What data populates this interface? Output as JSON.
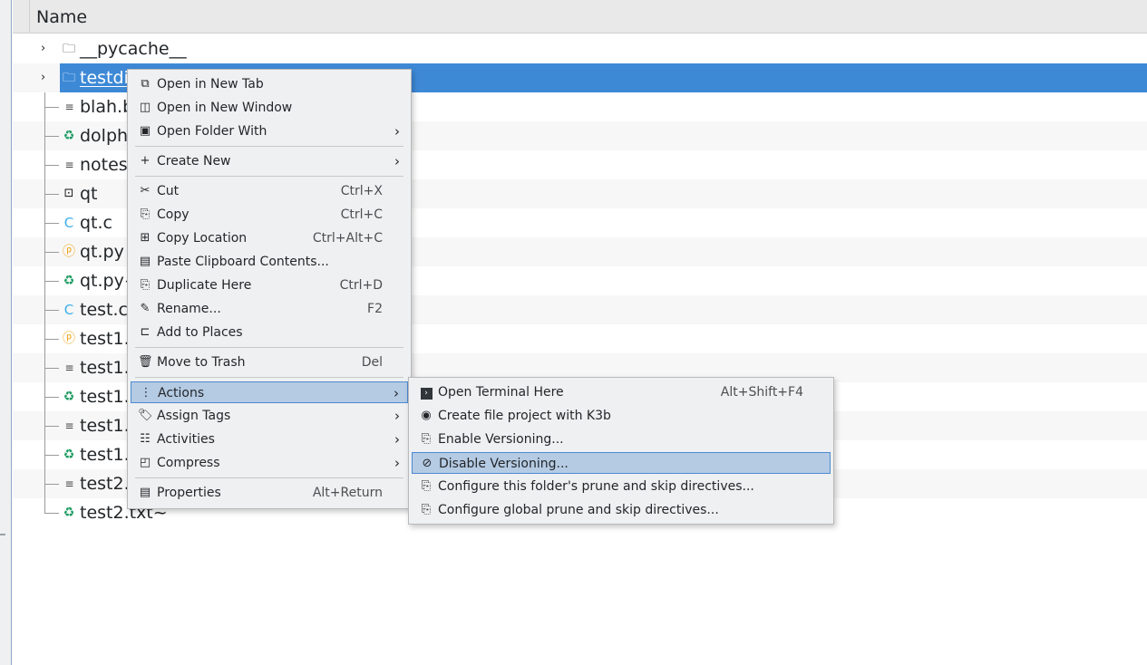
{
  "header": {
    "column_name": "Name"
  },
  "files": [
    {
      "name": "__pycache__",
      "icon": "folder-icon"
    },
    {
      "name": "testdi",
      "icon": "folder-icon",
      "selected": true
    },
    {
      "name": "blah.b",
      "icon": "text-file-icon"
    },
    {
      "name": "dolph",
      "icon": "backup-file-icon"
    },
    {
      "name": "notes",
      "icon": "text-file-icon"
    },
    {
      "name": "qt",
      "icon": "executable-icon"
    },
    {
      "name": "qt.c",
      "icon": "c-source-icon"
    },
    {
      "name": "qt.py",
      "icon": "python-file-icon"
    },
    {
      "name": "qt.py~",
      "icon": "backup-file-icon"
    },
    {
      "name": "test.c",
      "icon": "c-source-icon"
    },
    {
      "name": "test1.",
      "icon": "python-file-icon"
    },
    {
      "name": "test1.",
      "icon": "text-file-icon"
    },
    {
      "name": "test1.",
      "icon": "backup-file-icon"
    },
    {
      "name": "test1.",
      "icon": "text-file-icon"
    },
    {
      "name": "test1.",
      "icon": "backup-file-icon"
    },
    {
      "name": "test2.",
      "icon": "text-file-icon"
    },
    {
      "name": "test2.txt~",
      "icon": "backup-file-icon"
    }
  ],
  "context_menu": {
    "items": [
      {
        "label": "Open in New Tab",
        "shortcut": "",
        "icon": "new-tab-icon"
      },
      {
        "label": "Open in New Window",
        "shortcut": "",
        "icon": "new-window-icon"
      },
      {
        "label": "Open Folder With",
        "shortcut": "",
        "icon": "open-with-icon",
        "submenu": true
      },
      {
        "label": "Create New",
        "shortcut": "",
        "icon": "plus-icon",
        "submenu": true
      },
      {
        "label": "Cut",
        "shortcut": "Ctrl+X",
        "icon": "scissors-icon"
      },
      {
        "label": "Copy",
        "shortcut": "Ctrl+C",
        "icon": "copy-icon"
      },
      {
        "label": "Copy Location",
        "shortcut": "Ctrl+Alt+C",
        "icon": "copy-location-icon"
      },
      {
        "label": "Paste Clipboard Contents...",
        "shortcut": "",
        "icon": "paste-icon"
      },
      {
        "label": "Duplicate Here",
        "shortcut": "Ctrl+D",
        "icon": "duplicate-icon"
      },
      {
        "label": "Rename...",
        "shortcut": "F2",
        "icon": "pencil-icon"
      },
      {
        "label": "Add to Places",
        "shortcut": "",
        "icon": "bookmark-icon"
      },
      {
        "label": "Move to Trash",
        "shortcut": "Del",
        "icon": "trash-icon"
      },
      {
        "label": "Actions",
        "shortcut": "",
        "icon": "kebab-icon",
        "submenu": true,
        "active": true
      },
      {
        "label": "Assign Tags",
        "shortcut": "",
        "icon": "tag-icon",
        "submenu": true
      },
      {
        "label": "Activities",
        "shortcut": "",
        "icon": "activities-icon",
        "submenu": true
      },
      {
        "label": "Compress",
        "shortcut": "",
        "icon": "compress-icon",
        "submenu": true
      },
      {
        "label": "Properties",
        "shortcut": "Alt+Return",
        "icon": "properties-icon"
      }
    ]
  },
  "actions_submenu": {
    "items": [
      {
        "label": "Open Terminal Here",
        "shortcut": "Alt+Shift+F4",
        "icon": "terminal-icon"
      },
      {
        "label": "Create file project with K3b",
        "shortcut": "",
        "icon": "k3b-icon"
      },
      {
        "label": "Enable Versioning...",
        "shortcut": "",
        "icon": "versioning-icon"
      },
      {
        "label": "Disable Versioning...",
        "shortcut": "",
        "icon": "disable-icon",
        "active": true
      },
      {
        "label": "Configure this folder's prune and skip directives...",
        "shortcut": "",
        "icon": "versioning-icon"
      },
      {
        "label": "Configure global prune and skip directives...",
        "shortcut": "",
        "icon": "versioning-icon"
      }
    ]
  }
}
